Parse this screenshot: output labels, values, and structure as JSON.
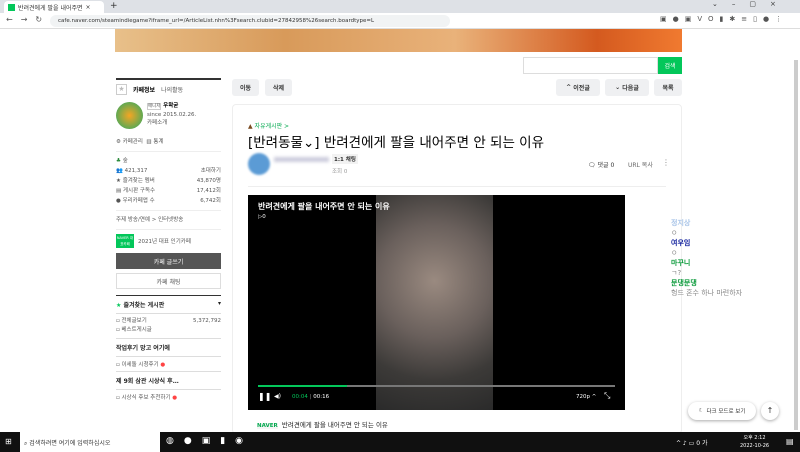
{
  "browser": {
    "tab_title": "반려견에게 팔을 내어주면",
    "url": "cafe.naver.com/steamindiegame?iframe_url=/ArticleList.nhn%3Fsearch.clubid=27842958%26search.boardtype=L"
  },
  "search": {
    "button": "검색",
    "value": ""
  },
  "sidebar": {
    "tab_info": "카페정보",
    "tab_activity": "나의활동",
    "manager_badge": "매니저",
    "manager": "우왁굳",
    "since": "since 2015.02.26.",
    "intro": "카페소개",
    "admin": "카페관리",
    "stats": "통계",
    "level": "숲",
    "members": "421,317",
    "invite": "초대하기",
    "stat_rows": [
      {
        "label": "즐겨찾는 멤버",
        "value": "43,870명"
      },
      {
        "label": "게시판 구독수",
        "value": "17,412회"
      },
      {
        "label": "우리카페앱 수",
        "value": "6,742회"
      }
    ],
    "topic": "주제 방송/연예 > 인터넷방송",
    "award_badge": "NAVER 대표카페",
    "award": "2021년 대표 인기카페",
    "write": "카페 글쓰기",
    "chat": "카페 채팅",
    "fav_boards": "즐겨찾는 게시판",
    "boards": [
      {
        "label": "전체글보기",
        "count": "5,372,792"
      },
      {
        "label": "베스트게시글"
      }
    ],
    "section1": "작업후기 망고 여기에",
    "board3": "이세돌 시청후기",
    "section2": "제 9회 삼관 시상식 후…",
    "board4": "시상식 후보 추천하기"
  },
  "toolbar": {
    "move": "이동",
    "delete": "삭제",
    "prev": "이전글",
    "next": "다음글",
    "list": "목록"
  },
  "article": {
    "board": "자유게시판 >",
    "category": "[반려동물⌄]",
    "title": "반려견에게 팔을 내어주면 안 되는 이유",
    "chat_badge": "1:1 채팅",
    "views": "조회 0",
    "comments": "댓글 0",
    "url_copy": "URL 복사"
  },
  "video": {
    "title": "반려견에게 팔을 내어주면 안 되는 이유",
    "plays": "▷0",
    "current": "00:04",
    "duration": "00:16",
    "quality": "720p",
    "progress": 0.25,
    "caption_brand": "NAVER",
    "caption": "반려견에게 팔을 내어주면 안 되는 이유"
  },
  "chat": [
    {
      "name": "정지상",
      "msg": "ㅇ",
      "color": "#a8c4e8"
    },
    {
      "name": "여우임",
      "msg": "ㅇ",
      "color": "#0a1a9a"
    },
    {
      "name": "마꾸니",
      "msg": "ㄱ?",
      "color": "#0a9a3a"
    },
    {
      "name": "문댕문댕",
      "msg": "헝드 혼수 하나 마련하자",
      "color": "#0a9a3a"
    }
  ],
  "dark_mode": "다크 모드로 보기",
  "taskbar": {
    "search": "검색하려면 여기에 입력하십시오",
    "time": "오후 2:12",
    "date": "2022-10-26"
  }
}
